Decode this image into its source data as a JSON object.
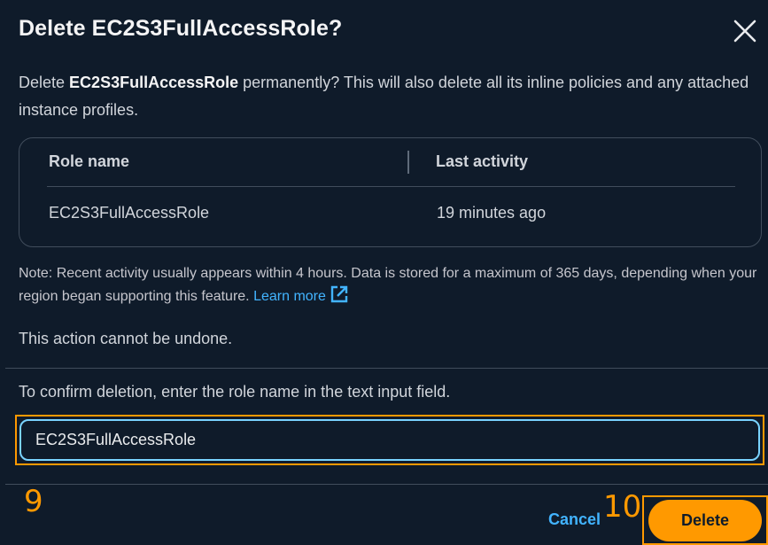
{
  "dialog": {
    "title": "Delete EC2S3FullAccessRole?",
    "lead_prefix": "Delete ",
    "role_bold": "EC2S3FullAccessRole",
    "lead_suffix": " permanently? This will also delete all its inline policies and any attached instance profiles.",
    "close_icon": "close-icon"
  },
  "table": {
    "headers": [
      "Role name",
      "Last activity"
    ],
    "rows": [
      [
        "EC2S3FullAccessRole",
        "19 minutes ago"
      ]
    ]
  },
  "note": {
    "text": "Note: Recent activity usually appears within 4 hours. Data is stored for a maximum of 365 days, depending when your region began supporting this feature. ",
    "link_label": "Learn more",
    "link_icon": "external-link-icon"
  },
  "warning": "This action cannot be undone.",
  "confirm": {
    "instruction": "To confirm deletion, enter the role name in the text input field.",
    "input_value": "EC2S3FullAccessRole"
  },
  "footer": {
    "cancel_label": "Cancel",
    "delete_label": "Delete"
  },
  "markers": {
    "left": "9",
    "right": "10"
  },
  "colors": {
    "background": "#0f1b2a",
    "accent": "#ff9900",
    "link": "#42b4ff",
    "input_border": "#7ad3ff"
  }
}
